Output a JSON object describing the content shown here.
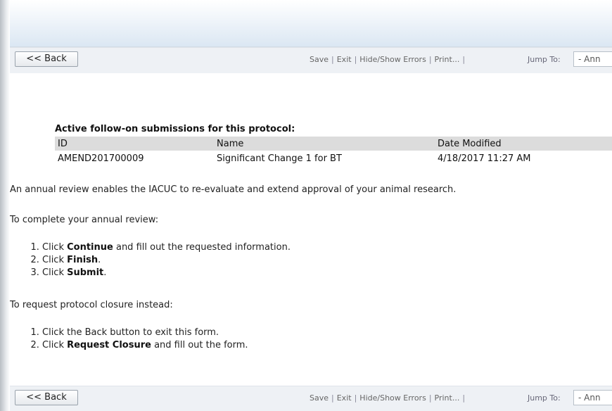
{
  "toolbar": {
    "back_label": "<< Back",
    "links": [
      "Save",
      "Exit",
      "Hide/Show Errors",
      "Print..."
    ],
    "jump_label": "Jump To:",
    "jump_value": "- Ann"
  },
  "submissions": {
    "title": "Active follow-on submissions for this protocol:",
    "columns": [
      "ID",
      "Name",
      "Date Modified"
    ],
    "rows": [
      {
        "id": "AMEND201700009",
        "name": "Significant Change 1 for BT",
        "date": "4/18/2017 11:27 AM"
      }
    ]
  },
  "intro": "An annual review enables the IACUC to re-evaluate and extend approval of your animal research.",
  "complete": {
    "heading": "To complete your annual review:",
    "steps": [
      {
        "pre": "Click ",
        "bold": "Continue",
        "post": " and fill out the requested information."
      },
      {
        "pre": "Click ",
        "bold": "Finish",
        "post": "."
      },
      {
        "pre": "Click ",
        "bold": "Submit",
        "post": "."
      }
    ]
  },
  "closure": {
    "heading": "To request protocol closure instead:",
    "steps": [
      {
        "pre": "Click the Back button to exit this form.",
        "bold": "",
        "post": ""
      },
      {
        "pre": "Click ",
        "bold": "Request Closure",
        "post": " and fill out the form."
      }
    ]
  }
}
